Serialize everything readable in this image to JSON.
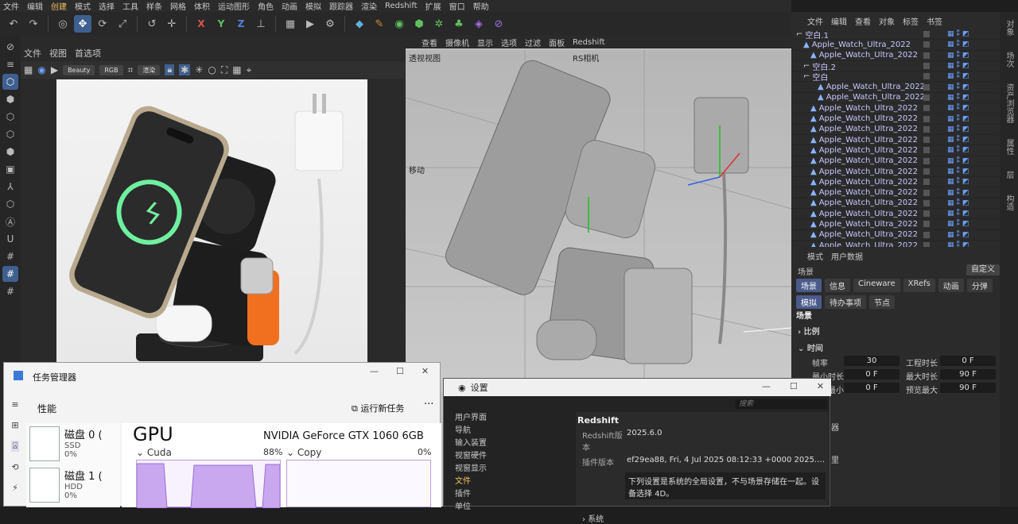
{
  "menubar": [
    "文件",
    "编辑",
    "创建",
    "模式",
    "选择",
    "工具",
    "样条",
    "网格",
    "体积",
    "运动图形",
    "角色",
    "动画",
    "模拟",
    "跟踪器",
    "渲染",
    "Redshift",
    "扩展",
    "窗口",
    "帮助"
  ],
  "toolbar": {
    "axis_x": "X",
    "axis_y": "Y",
    "axis_z": "Z"
  },
  "render_view": {
    "menu": [
      "文件",
      "视图",
      "首选项"
    ],
    "aov_dropdown": "Beauty",
    "color_dropdown": "RGB",
    "mode_dropdown": "渲染"
  },
  "viewport": {
    "menu": [
      "查看",
      "摄像机",
      "显示",
      "选项",
      "过滤",
      "面板",
      "Redshift"
    ],
    "label_view": "透视视图",
    "label_camera": "RS相机",
    "label_move": "移动"
  },
  "object_manager": {
    "menu": [
      "文件",
      "编辑",
      "查看",
      "对象",
      "标签",
      "书签"
    ],
    "rows": [
      {
        "name": "空白.1",
        "indent": 0
      },
      {
        "name": "Apple_Watch_Ultra_2022",
        "indent": 1
      },
      {
        "name": "Apple_Watch_Ultra_2022",
        "indent": 2
      },
      {
        "name": "空白.2",
        "indent": 1
      },
      {
        "name": "空白",
        "indent": 1
      },
      {
        "name": "Apple_Watch_Ultra_2022",
        "indent": 3
      },
      {
        "name": "Apple_Watch_Ultra_2022",
        "indent": 3
      },
      {
        "name": "Apple_Watch_Ultra_2022",
        "indent": 2
      },
      {
        "name": "Apple_Watch_Ultra_2022",
        "indent": 2
      },
      {
        "name": "Apple_Watch_Ultra_2022",
        "indent": 2
      },
      {
        "name": "Apple_Watch_Ultra_2022",
        "indent": 2
      },
      {
        "name": "Apple_Watch_Ultra_2022",
        "indent": 2
      },
      {
        "name": "Apple_Watch_Ultra_2022",
        "indent": 2
      },
      {
        "name": "Apple_Watch_Ultra_2022",
        "indent": 2
      },
      {
        "name": "Apple_Watch_Ultra_2022",
        "indent": 2
      },
      {
        "name": "Apple_Watch_Ultra_2022",
        "indent": 2
      },
      {
        "name": "Apple_Watch_Ultra_2022",
        "indent": 2
      },
      {
        "name": "Apple_Watch_Ultra_2022",
        "indent": 2
      },
      {
        "name": "Apple_Watch_Ultra_2022",
        "indent": 2
      },
      {
        "name": "Apple_Watch_Ultra_2022",
        "indent": 2
      },
      {
        "name": "Apple_Watch_Ultra_2022",
        "indent": 2
      }
    ]
  },
  "right_strip": [
    "对象",
    "场次",
    "资产浏览器",
    "属性",
    "层",
    "构造"
  ],
  "attributes": {
    "menu": [
      "模式",
      "用户数据"
    ],
    "scene_label": "场景",
    "preset": "自定义",
    "tabs_row1": [
      "场景",
      "信息",
      "Cineware",
      "XRefs",
      "动画",
      "分弹"
    ],
    "tabs_row2": [
      "模拟",
      "待办事项",
      "节点"
    ],
    "section_scene": "场景",
    "group_scale": "比例",
    "group_time": "时间",
    "fps_label": "帧率",
    "fps_value": "30",
    "duration_label": "工程时长",
    "duration_value": "0 F",
    "min_label": "最小时长",
    "min_value": "0 F",
    "max_label": "最大时长",
    "max_value": "90 F",
    "pmin_label": "预览最小",
    "pmin_value": "0 F",
    "pmax_label": "预览最大",
    "pmax_value": "90 F",
    "extra1": "器",
    "extra2": "里"
  },
  "task_manager": {
    "title": "任务管理器",
    "section": "性能",
    "new_task": "运行新任务",
    "more": "···",
    "devices": [
      {
        "name": "磁盘 0 (",
        "type": "SSD",
        "usage": "0%"
      },
      {
        "name": "磁盘 1 (",
        "type": "HDD",
        "usage": "0%"
      }
    ],
    "gpu_title": "GPU",
    "gpu_name": "NVIDIA GeForce GTX 1060 6GB",
    "graph1_label": "Cuda",
    "graph1_value": "88%",
    "graph2_label": "Copy",
    "graph2_value": "0%"
  },
  "settings": {
    "title": "设置",
    "search_placeholder": "搜索",
    "nav": [
      "用户界面",
      "导航",
      "输入装置",
      "视窗硬件",
      "视窗显示",
      "文件",
      "插件",
      "单位"
    ],
    "active_nav": "文件",
    "heading": "Redshift",
    "version_label": "Redshift版本",
    "version_value": "2025.6.0",
    "plugin_label": "插件版本",
    "plugin_value": "ef29ea88, Fri, 4 Jul 2025 08:12:33 +0000 2025.3.0 Re...",
    "note": "下列设置是系统的全局设置，不与场景存储在一起。设备选择 4D。",
    "footer": "系统"
  },
  "colors": {
    "accent": "#3f5f8f",
    "highlight": "#f0c060",
    "object_name": "#c8c8ff"
  }
}
